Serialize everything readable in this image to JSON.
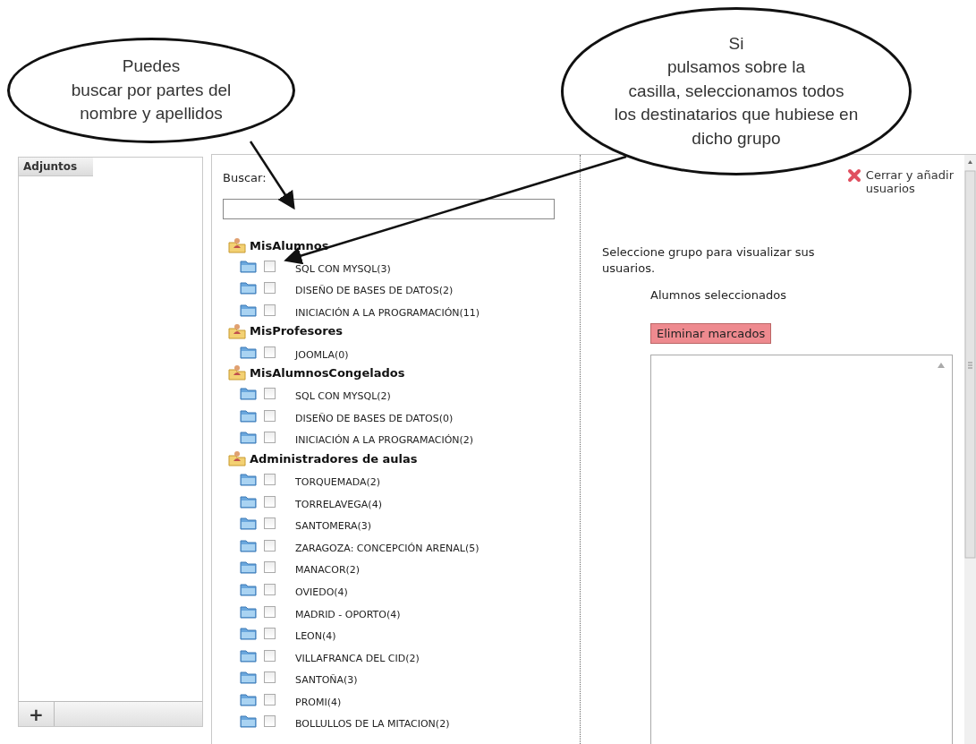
{
  "callouts": [
    {
      "text": "Puedes\nbuscar por partes del\nnombre y apellidos"
    },
    {
      "text": "Si\npulsamos sobre la\ncasilla, seleccionamos todos\nlos destinatarios que hubiese en\ndicho grupo"
    }
  ],
  "attachments": {
    "title": "Adjuntos",
    "add_button": "+"
  },
  "search": {
    "label": "Buscar:"
  },
  "close_link": "Cerrar y añadir\nusuarios",
  "groups": [
    {
      "name": "MisAlumnos",
      "items": [
        {
          "label": "SQL CON MYSQL(3)",
          "checked": false
        },
        {
          "label": "DISEÑO DE BASES DE DATOS(2)",
          "checked": false
        },
        {
          "label": "INICIACIÓN A LA PROGRAMACIÓN(11)",
          "checked": false
        }
      ]
    },
    {
      "name": "MisProfesores",
      "items": [
        {
          "label": "JOOMLA(0)",
          "checked": false
        }
      ]
    },
    {
      "name": "MisAlumnosCongelados",
      "items": [
        {
          "label": "SQL CON MYSQL(2)",
          "checked": false
        },
        {
          "label": "DISEÑO DE BASES DE DATOS(0)",
          "checked": false
        },
        {
          "label": "INICIACIÓN A LA PROGRAMACIÓN(2)",
          "checked": false
        }
      ]
    },
    {
      "name": "Administradores de aulas",
      "items": [
        {
          "label": "TORQUEMADA(2)",
          "checked": false
        },
        {
          "label": "TORRELAVEGA(4)",
          "checked": false
        },
        {
          "label": "SANTOMERA(3)",
          "checked": false
        },
        {
          "label": "ZARAGOZA: CONCEPCIÓN ARENAL(5)",
          "checked": false
        },
        {
          "label": "MANACOR(2)",
          "checked": false
        },
        {
          "label": "OVIEDO(4)",
          "checked": false
        },
        {
          "label": "MADRID - OPORTO(4)",
          "checked": false
        },
        {
          "label": "LEON(4)",
          "checked": false
        },
        {
          "label": "VILLAFRANCA DEL CID(2)",
          "checked": false
        },
        {
          "label": "SANTOÑA(3)",
          "checked": false
        },
        {
          "label": "PROMI(4)",
          "checked": false
        },
        {
          "label": "BOLLULLOS DE LA MITACION(2)",
          "checked": false
        }
      ]
    }
  ],
  "hint": "Seleccione grupo para visualizar sus usuarios.",
  "selected_title": "Alumnos seleccionados",
  "remove_button": "Eliminar marcados"
}
